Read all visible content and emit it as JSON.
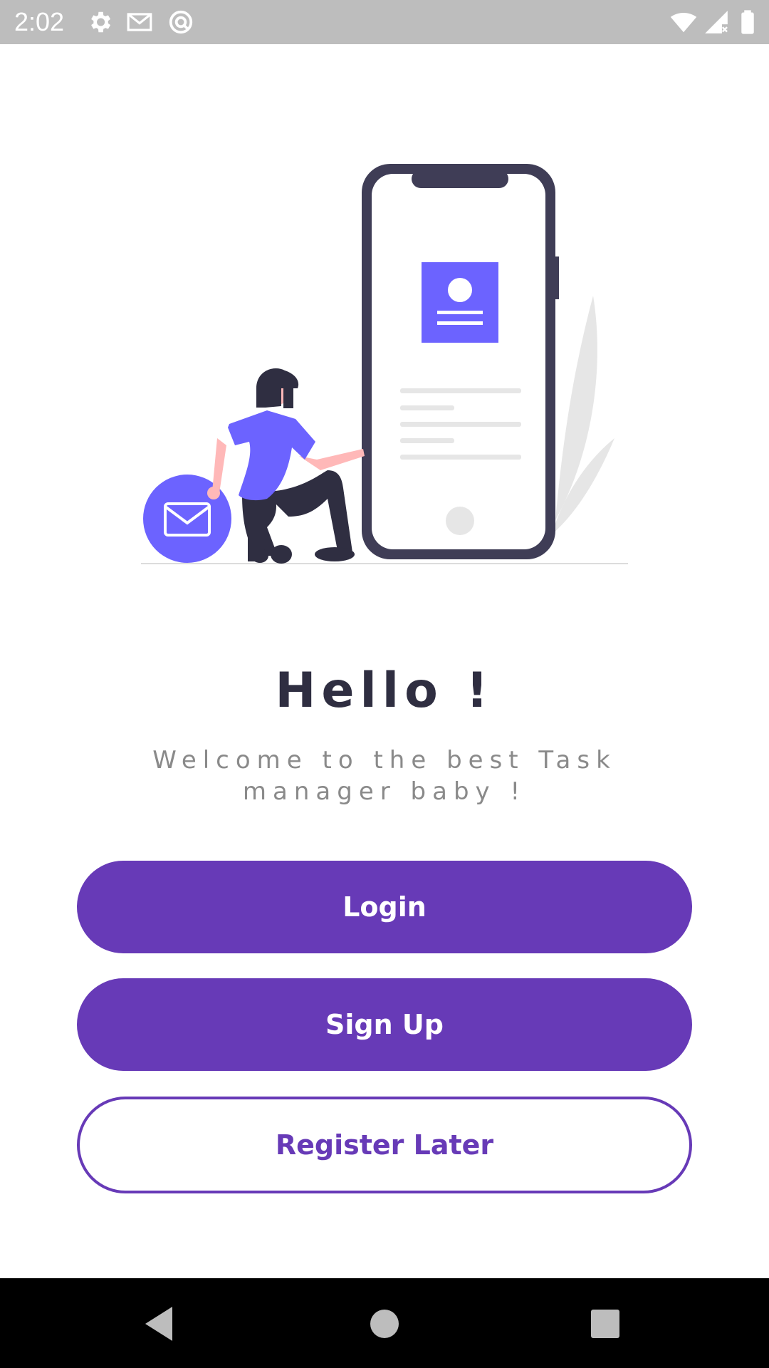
{
  "status_bar": {
    "time": "2:02",
    "left_icons": [
      "gear-icon",
      "gmail-icon",
      "data-saver-icon"
    ],
    "right_icons": [
      "wifi-icon",
      "signal-icon",
      "battery-icon"
    ],
    "background": "#bdbdbd"
  },
  "welcome": {
    "title": "Hello !",
    "subtitle": "Welcome to the best Task manager baby !"
  },
  "buttons": {
    "login": "Login",
    "sign_up": "Sign Up",
    "register_later": "Register Later"
  },
  "nav_bar": {
    "icons": [
      "back-icon",
      "home-icon",
      "recents-icon"
    ]
  },
  "colors": {
    "primary": "#673ab7",
    "illustration_accent": "#6c63ff",
    "dark": "#2f2e41"
  }
}
